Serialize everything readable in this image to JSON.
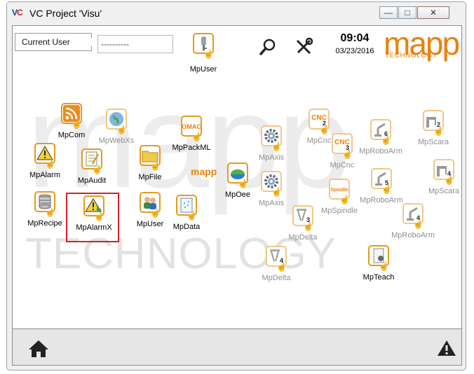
{
  "window": {
    "logo_text_a": "V",
    "logo_text_b": "C",
    "title": "VC Project 'Visu'",
    "minimize": "—",
    "maximize": "□",
    "close": "✕"
  },
  "header": {
    "current_user_label": "Current User",
    "current_user_value": "----------",
    "time": "09:04",
    "date": "03/23/2016",
    "logo_mapp": "mapp",
    "logo_tech": "TECHNOLOGY",
    "mpuser_tool_label": "MpUser"
  },
  "watermark": {
    "mapp": "mapp",
    "technology": "TECHNOLOGY"
  },
  "center_logo": "mapp",
  "tiles": [
    {
      "label": "MpCom",
      "icon": "rss-icon",
      "dim": false
    },
    {
      "label": "MpWebXs",
      "icon": "globe-icon",
      "dim": true
    },
    {
      "label": "MpPackML",
      "icon": "omac-icon",
      "dim": false,
      "badge": "OMAC"
    },
    {
      "label": "MpAlarm",
      "icon": "warning-icon",
      "dim": false
    },
    {
      "label": "MpAudit",
      "icon": "notepad-icon",
      "dim": false
    },
    {
      "label": "MpFile",
      "icon": "folder-icon",
      "dim": false
    },
    {
      "label": "MpOee",
      "icon": "oee-icon",
      "dim": false
    },
    {
      "label": "MpRecipe",
      "icon": "database-icon",
      "dim": false
    },
    {
      "label": "MpAlarmX",
      "icon": "warning-arrow-icon",
      "dim": false
    },
    {
      "label": "MpUser",
      "icon": "users-icon",
      "dim": false
    },
    {
      "label": "MpData",
      "icon": "data-sheet-icon",
      "dim": false
    },
    {
      "label": "MpAxis",
      "icon": "gear-icon",
      "dim": true
    },
    {
      "label": "MpCnc",
      "icon": "cnc-icon",
      "dim": true,
      "badge": "CNC",
      "num": "2"
    },
    {
      "label": "MpCnc",
      "icon": "cnc-icon",
      "dim": true,
      "badge": "CNC",
      "num": "3"
    },
    {
      "label": "MpRoboArm",
      "icon": "robot-arm-icon",
      "dim": true,
      "num": "6"
    },
    {
      "label": "MpScara",
      "icon": "scara-icon",
      "dim": true,
      "num": "2"
    },
    {
      "label": "MpAxis",
      "icon": "gear-icon",
      "dim": true
    },
    {
      "label": "MpSpindle",
      "icon": "spindle-icon",
      "dim": true,
      "badge": "Spindle"
    },
    {
      "label": "MpRoboArm",
      "icon": "robot-arm-icon",
      "dim": true,
      "num": "5"
    },
    {
      "label": "MpScara",
      "icon": "scara-icon",
      "dim": true,
      "num": "4"
    },
    {
      "label": "MpDelta",
      "icon": "delta-robot-icon",
      "dim": true,
      "num": "3"
    },
    {
      "label": "MpRoboArm",
      "icon": "robot-arm-icon",
      "dim": true,
      "num": "4"
    },
    {
      "label": "MpDelta",
      "icon": "delta-robot-icon",
      "dim": true,
      "num": "4"
    },
    {
      "label": "MpTeach",
      "icon": "teach-icon",
      "dim": false
    }
  ],
  "footer": {
    "home_icon": "home-icon",
    "alarm_icon": "warning-icon"
  },
  "colors": {
    "accent": "#e8820e",
    "tile_border": "#e69a1a",
    "selection": "#d81f26",
    "dim_text": "#8f8f8f"
  }
}
